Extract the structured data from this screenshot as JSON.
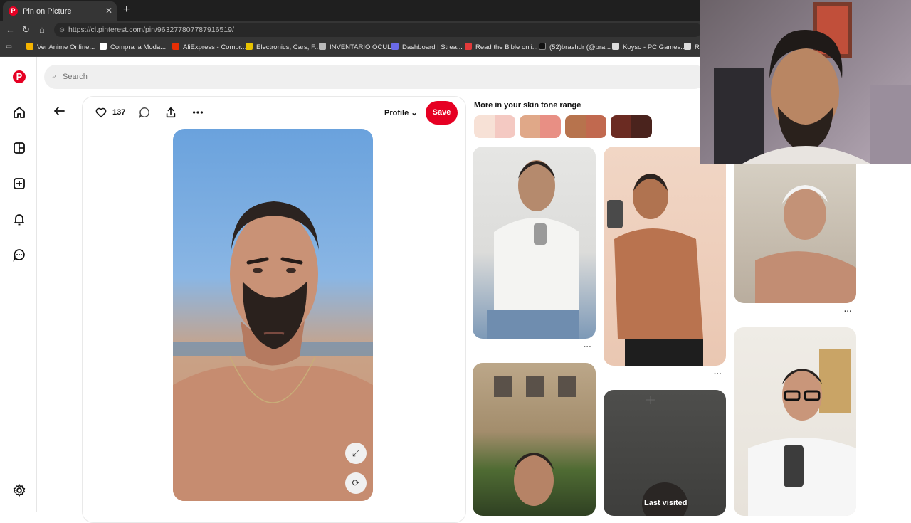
{
  "browser": {
    "tab_title": "Pin on Picture",
    "url": "https://cl.pinterest.com/pin/963277807787916519/",
    "bookmarks": [
      {
        "label": "Ver Anime Online...",
        "color": "#f5b400"
      },
      {
        "label": "Compra la Moda...",
        "color": "#ffffff"
      },
      {
        "label": "AliExpress - Compr...",
        "color": "#e62e04"
      },
      {
        "label": "Electronics, Cars, F...",
        "color": "#e8c300"
      },
      {
        "label": "INVENTARIO OCUL...",
        "color": "#bbbbbb"
      },
      {
        "label": "Dashboard | Strea...",
        "color": "#6a6ae8"
      },
      {
        "label": "Read the Bible onli...",
        "color": "#e33a3a"
      },
      {
        "label": "(52)brashdr (@bra...",
        "color": "#111111"
      },
      {
        "label": "Koyso - PC Games...",
        "color": "#dddddd"
      },
      {
        "label": "RC",
        "color": "#dddddd"
      }
    ]
  },
  "app": {
    "logo": "P",
    "search_placeholder": "Search",
    "nav_icons": [
      "home-icon",
      "explore-icon",
      "create-icon",
      "notifications-icon",
      "messages-icon",
      "settings-icon"
    ]
  },
  "pin": {
    "like_count": "137",
    "profile_label": "Profile",
    "save_label": "Save"
  },
  "related": {
    "heading": "More in your skin tone range",
    "last_visited": "Last visited",
    "swatches": [
      [
        "#f7e1d6",
        "#f4c9c2"
      ],
      [
        "#e0a888",
        "#e88f84"
      ],
      [
        "#b7734d",
        "#c1694f"
      ],
      [
        "#6b2b22",
        "#4a231d"
      ]
    ]
  }
}
